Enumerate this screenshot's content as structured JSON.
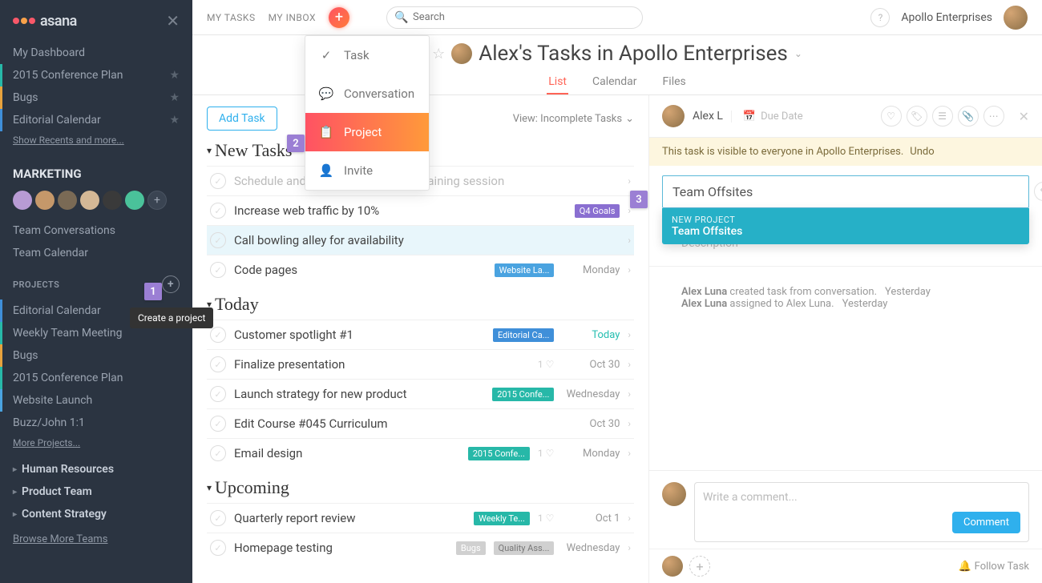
{
  "brand": "asana",
  "topnav": {
    "my_tasks": "MY TASKS",
    "my_inbox": "MY INBOX",
    "search_placeholder": "Search",
    "org": "Apollo Enterprises"
  },
  "sidebar": {
    "dashboard": "My Dashboard",
    "favorites": [
      {
        "label": "2015 Conference Plan",
        "color": "#27b8a8"
      },
      {
        "label": "Bugs",
        "color": "#e8a33d"
      },
      {
        "label": "Editorial Calendar",
        "color": "#3f8fd9"
      }
    ],
    "show_recents": "Show Recents and more...",
    "team": "MARKETING",
    "team_links": [
      "Team Conversations",
      "Team Calendar"
    ],
    "projects_label": "PROJECTS",
    "projects": [
      {
        "label": "Editorial Calendar",
        "color": "#3f8fd9"
      },
      {
        "label": "Weekly Team Meeting",
        "color": "#27b8a8"
      },
      {
        "label": "Bugs",
        "color": "#e8a33d"
      },
      {
        "label": "2015 Conference Plan",
        "color": "#27b8a8"
      },
      {
        "label": "Website Launch",
        "color": "#4aa3e0"
      },
      {
        "label": "Buzz/John 1:1",
        "color": ""
      }
    ],
    "more_projects": "More Projects...",
    "teams": [
      "Human Resources",
      "Product Team",
      "Content Strategy"
    ],
    "browse": "Browse More Teams"
  },
  "page": {
    "title": "Alex's Tasks in Apollo Enterprises",
    "tabs": [
      "List",
      "Calendar",
      "Files"
    ],
    "active_tab": 0
  },
  "tasklist": {
    "add_task": "Add Task",
    "view_label": "View: Incomplete Tasks",
    "groups": [
      {
        "name": "New Tasks",
        "tasks": [
          {
            "name": "Schedule and organize anti-gravity training session",
            "muted": true
          },
          {
            "name": "Increase web traffic by 10%",
            "tag": "Q4 Goals",
            "tag_color": "#8a6fd1"
          },
          {
            "name": "Call bowling alley for availability",
            "highlight": true
          },
          {
            "name": "Code pages",
            "tag": "Website La...",
            "tag_color": "#4aa3e0",
            "date": "Monday"
          }
        ]
      },
      {
        "name": "Today",
        "tasks": [
          {
            "name": "Customer spotlight #1",
            "tag": "Editorial Ca...",
            "tag_color": "#3f8fd9",
            "date": "Today",
            "today": true
          },
          {
            "name": "Finalize presentation",
            "likes": 1,
            "date": "Oct 30"
          },
          {
            "name": "Launch strategy for new product",
            "tag": "2015 Confe...",
            "tag_color": "#27b8a8",
            "date": "Wednesday"
          },
          {
            "name": "Edit Course #045 Curriculum",
            "date": "Oct 30"
          },
          {
            "name": "Email design",
            "tag": "2015 Confe...",
            "tag_color": "#27b8a8",
            "likes": 1,
            "date": "Monday"
          }
        ]
      },
      {
        "name": "Upcoming",
        "tasks": [
          {
            "name": "Quarterly report review",
            "tag": "Weekly Te...",
            "tag_color": "#27b8a8",
            "likes": 1,
            "date": "Oct 1"
          },
          {
            "name": "Homepage testing",
            "tag": "Bugs",
            "tag_color": "#d0d0d0",
            "tag2": "Quality Ass...",
            "tag2_color": "#d0d0d0",
            "date": "Wednesday"
          }
        ]
      }
    ]
  },
  "detail": {
    "assignee": "Alex L",
    "due_label": "Due Date",
    "banner": "This task is visible to everyone in Apollo Enterprises.",
    "undo": "Undo",
    "project_input": "Team Offsites",
    "dropdown_label": "NEW PROJECT",
    "dropdown_value": "Team Offsites",
    "description_ph": "Description",
    "activity": [
      {
        "who": "Alex Luna",
        "what": " created task from conversation.",
        "when": "Yesterday"
      },
      {
        "who": "Alex Luna",
        "what": " assigned to Alex Luna.",
        "when": "Yesterday"
      }
    ],
    "comment_ph": "Write a comment...",
    "comment_btn": "Comment",
    "follow": "Follow Task"
  },
  "create_menu": {
    "items": [
      "Task",
      "Conversation",
      "Project",
      "Invite"
    ],
    "active": 2
  },
  "tooltip": "Create a project",
  "callouts": {
    "c1": "1",
    "c2": "2",
    "c3": "3"
  }
}
